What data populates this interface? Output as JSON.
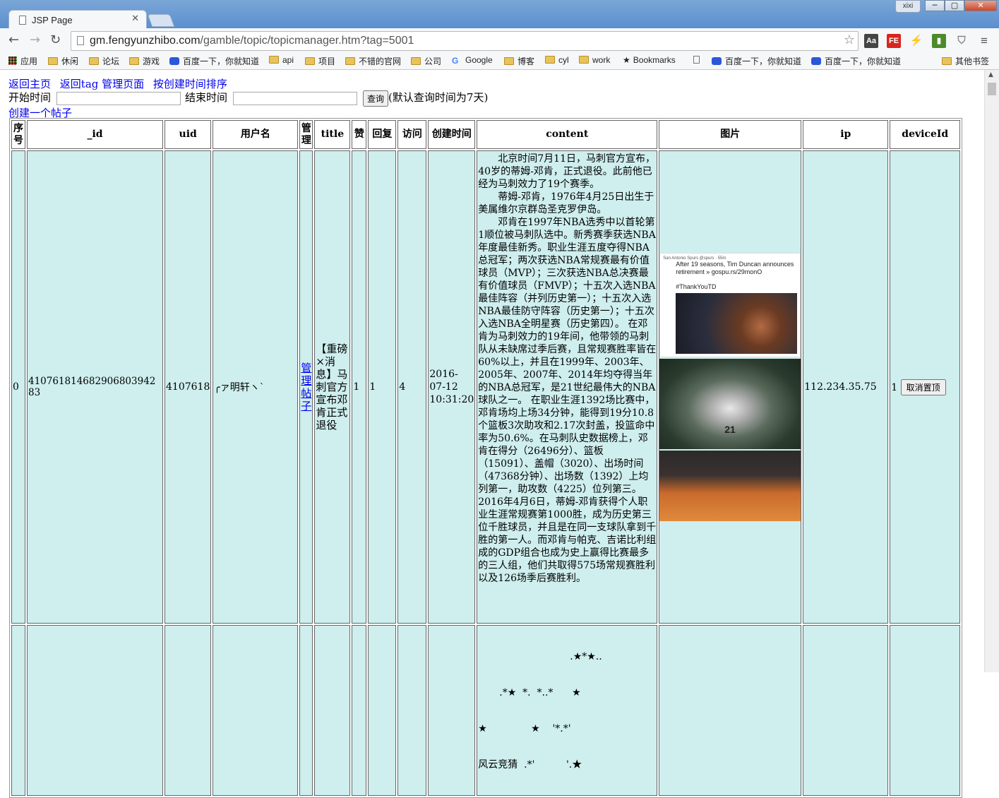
{
  "browser": {
    "tab_title": "JSP Page",
    "tab_close": "✕",
    "user_badge": "xixi",
    "url_host": "gm.fengyunzhibo.com",
    "url_path": "/gamble/topic/topicmanager.htm?tag=5001"
  },
  "bookmarks": [
    {
      "label": "应用",
      "icon": "apps-icon"
    },
    {
      "label": "休闲",
      "icon": "folder-icon"
    },
    {
      "label": "论坛",
      "icon": "folder-icon"
    },
    {
      "label": "游戏",
      "icon": "folder-icon"
    },
    {
      "label": "百度一下，你就知道",
      "icon": "baidu-paw-icon"
    },
    {
      "label": "api",
      "icon": "folder-icon"
    },
    {
      "label": "项目",
      "icon": "folder-icon"
    },
    {
      "label": "不错的官网",
      "icon": "folder-icon"
    },
    {
      "label": "公司",
      "icon": "folder-icon"
    },
    {
      "label": "Google",
      "icon": "google-icon"
    },
    {
      "label": "博客",
      "icon": "folder-icon"
    },
    {
      "label": "cyl",
      "icon": "folder-icon"
    },
    {
      "label": "work",
      "icon": "folder-icon"
    },
    {
      "label": "Bookmarks",
      "icon": "star-icon"
    },
    {
      "label": "",
      "icon": "page-icon"
    },
    {
      "label": "百度一下，你就知道",
      "icon": "baidu-paw-icon"
    },
    {
      "label": "百度一下，你就知道",
      "icon": "baidu-paw-icon"
    },
    {
      "label": "其他书签",
      "icon": "folder-icon"
    }
  ],
  "page": {
    "link_home": "返回主页",
    "link_tag": "返回tag 管理页面",
    "link_sort": "按创建时间排序",
    "start_label": "开始时间",
    "end_label": "结束时间",
    "start_value": "",
    "end_value": "",
    "query_button": "查询",
    "query_hint": "(默认查询时间为7天)",
    "create_post": "创建一个帖子"
  },
  "table": {
    "headers": [
      "序号",
      "_id",
      "uid",
      "用户名",
      "管理",
      "title",
      "赞",
      "回复",
      "访问",
      "创建时间",
      "content",
      "图片",
      "ip",
      "deviceId"
    ],
    "rows": [
      {
        "index": "0",
        "id": "410761814682906803942 83",
        "uid": "4107618",
        "username": "╭ァ明轩ヽ`",
        "manage": "管理帖子",
        "title": "【重磅×消息】马刺官方宣布邓肯正式退役",
        "likes": "1",
        "replies": "1",
        "visits": "4",
        "created": "2016-07-12 10:31:20",
        "content": [
          "北京时间7月11日，马刺官方宣布，40岁的蒂姆-邓肯，正式退役。此前他已经为马刺效力了19个赛季。",
          "蒂姆-邓肯，1976年4月25日出生于美属维尔京群岛圣克罗伊岛。",
          "邓肯在1997年NBA选秀中以首轮第1顺位被马刺队选中。新秀赛季获选NBA年度最佳新秀。职业生涯五度夺得NBA总冠军；两次获选NBA常规赛最有价值球员（MVP）；三次获选NBA总决赛最有价值球员（FMVP）；十五次入选NBA最佳阵容（并列历史第一）；十五次入选NBA最佳防守阵容（历史第一）；十五次入选NBA全明星赛（历史第四）。        在邓肯为马刺效力的19年间，他带领的马刺队从未缺席过季后赛，且常规赛胜率皆在60%以上，并且在1999年、2003年、2005年、2007年、2014年均夺得当年的NBA总冠军，是21世纪最伟大的NBA球队之一。        在职业生涯1392场比赛中，邓肯场均上场34分钟，能得到19分10.8个篮板3次助攻和2.17次封盖，投篮命中率为50.6%。在马刺队史数据榜上，邓肯在得分（26496分）、篮板（15091）、盖帽（3020）、出场时间（47368分钟）、出场数（1392）上均列第一，助攻数（4225）位列第三。        2016年4月6日，蒂姆-邓肯获得个人职业生涯常规赛第1000胜，成为历史第三位千胜球员，并且是在同一支球队拿到千胜的第一人。而邓肯与帕克、吉诺比利组成的GDP组合也成为史上赢得比赛最多的三人组，他们共取得575场常规赛胜利以及126场季后赛胜利。"
        ],
        "tweet_header": "San Antonio Spurs @spurs · 55m",
        "tweet_text": "After 19 seasons, Tim Duncan announces retirement » gospu.rs/29monO",
        "tweet_tag": "#ThankYouTD",
        "jersey": "21",
        "ip": "112.234.35.75",
        "device_id": "1",
        "action_button": "取消置顶"
      }
    ],
    "row2_content": [
      ".★*★..",
      ".*★  *.  *..*      ★",
      "★              ★    '*.*'",
      "风云竞猜  .*'          '.★"
    ]
  }
}
